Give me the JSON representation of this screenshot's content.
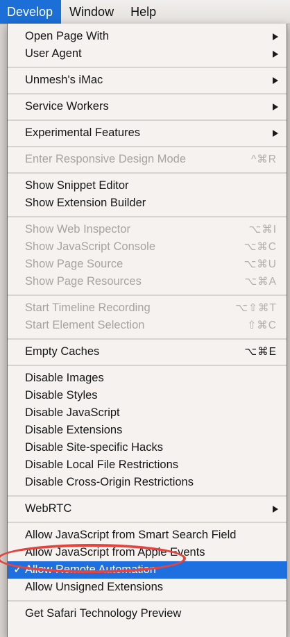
{
  "menubar": {
    "items": [
      "Develop",
      "Window",
      "Help"
    ]
  },
  "menu": {
    "group1": [
      {
        "label": "Open Page With",
        "submenu": true
      },
      {
        "label": "User Agent",
        "submenu": true
      }
    ],
    "group2": [
      {
        "label": "Unmesh's iMac",
        "submenu": true
      }
    ],
    "group3": [
      {
        "label": "Service Workers",
        "submenu": true
      }
    ],
    "group4": [
      {
        "label": "Experimental Features",
        "submenu": true
      }
    ],
    "group5": [
      {
        "label": "Enter Responsive Design Mode",
        "shortcut": "^⌘R",
        "disabled": true
      }
    ],
    "group6": [
      {
        "label": "Show Snippet Editor"
      },
      {
        "label": "Show Extension Builder"
      }
    ],
    "group7": [
      {
        "label": "Show Web Inspector",
        "shortcut": "⌥⌘I",
        "disabled": true
      },
      {
        "label": "Show JavaScript Console",
        "shortcut": "⌥⌘C",
        "disabled": true
      },
      {
        "label": "Show Page Source",
        "shortcut": "⌥⌘U",
        "disabled": true
      },
      {
        "label": "Show Page Resources",
        "shortcut": "⌥⌘A",
        "disabled": true
      }
    ],
    "group8": [
      {
        "label": "Start Timeline Recording",
        "shortcut": "⌥⇧⌘T",
        "disabled": true
      },
      {
        "label": "Start Element Selection",
        "shortcut": "⇧⌘C",
        "disabled": true
      }
    ],
    "group9": [
      {
        "label": "Empty Caches",
        "shortcut": "⌥⌘E"
      }
    ],
    "group10": [
      {
        "label": "Disable Images"
      },
      {
        "label": "Disable Styles"
      },
      {
        "label": "Disable JavaScript"
      },
      {
        "label": "Disable Extensions"
      },
      {
        "label": "Disable Site-specific Hacks"
      },
      {
        "label": "Disable Local File Restrictions"
      },
      {
        "label": "Disable Cross-Origin Restrictions"
      }
    ],
    "group11": [
      {
        "label": "WebRTC",
        "submenu": true
      }
    ],
    "group12": [
      {
        "label": "Allow JavaScript from Smart Search Field"
      },
      {
        "label": "Allow JavaScript from Apple Events"
      },
      {
        "label": "Allow Remote Automation",
        "checked": true,
        "check": "✓"
      },
      {
        "label": "Allow Unsigned Extensions"
      }
    ],
    "group13": [
      {
        "label": "Get Safari Technology Preview"
      }
    ]
  },
  "colors": {
    "selection": "#1e6fe0",
    "annotation": "#e2453f"
  }
}
